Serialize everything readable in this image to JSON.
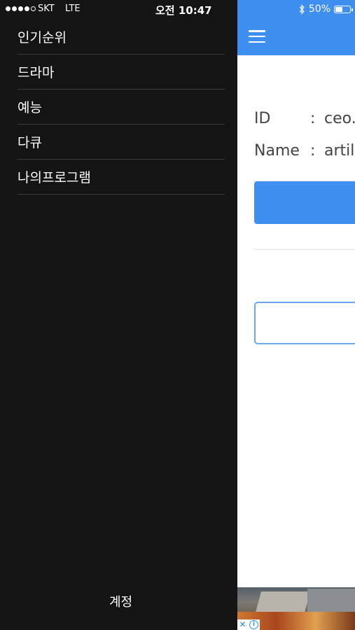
{
  "status_bar": {
    "carrier": "SKT",
    "network": "LTE",
    "time": "오전 10:47",
    "battery_percent": "50%",
    "battery_level": 0.5,
    "signal_bars": 4
  },
  "drawer": {
    "menu": [
      {
        "label": "인기순위"
      },
      {
        "label": "드라마"
      },
      {
        "label": "예능"
      },
      {
        "label": "다큐"
      },
      {
        "label": "나의프로그램"
      }
    ],
    "account_label": "계정"
  },
  "main": {
    "id_label": "ID",
    "id_separator": ":",
    "id_value": "ceo.",
    "name_label": "Name",
    "name_separator": ":",
    "name_value": "artil"
  },
  "ad": {
    "close_glyph": "✕",
    "info_glyph": "i"
  },
  "colors": {
    "accent": "#3f8ff0",
    "drawer_bg": "#141414",
    "input_border": "#6aaaf0"
  }
}
